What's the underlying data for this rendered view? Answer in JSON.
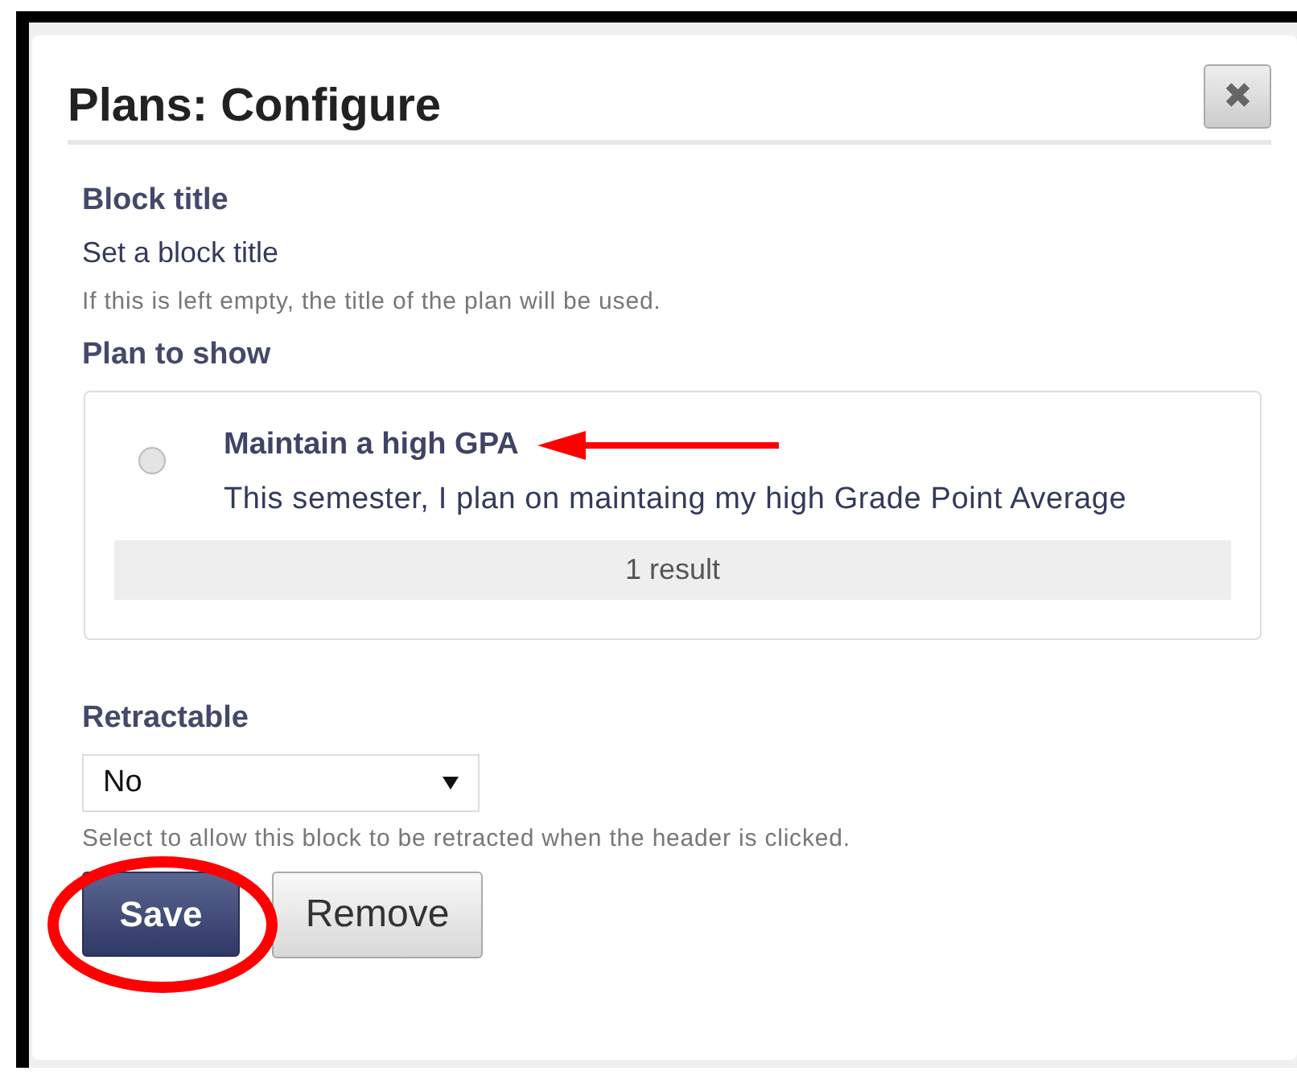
{
  "dialog": {
    "title": "Plans: Configure",
    "close_label": "✖"
  },
  "block_title": {
    "label": "Block title",
    "value": "Set a block title",
    "hint": "If this is left empty, the title of the plan will be used."
  },
  "plan_to_show": {
    "label": "Plan to show",
    "plans": [
      {
        "title": "Maintain a high GPA",
        "description": "This semester, I plan on maintaing my high Grade Point Average",
        "selected": false
      }
    ],
    "result_count": "1 result"
  },
  "retractable": {
    "label": "Retractable",
    "value": "No",
    "hint": "Select to allow this block to be retracted when the header is clicked."
  },
  "buttons": [
    {
      "label": "Save",
      "kind": "primary"
    },
    {
      "label": "Remove",
      "kind": "secondary"
    }
  ]
}
